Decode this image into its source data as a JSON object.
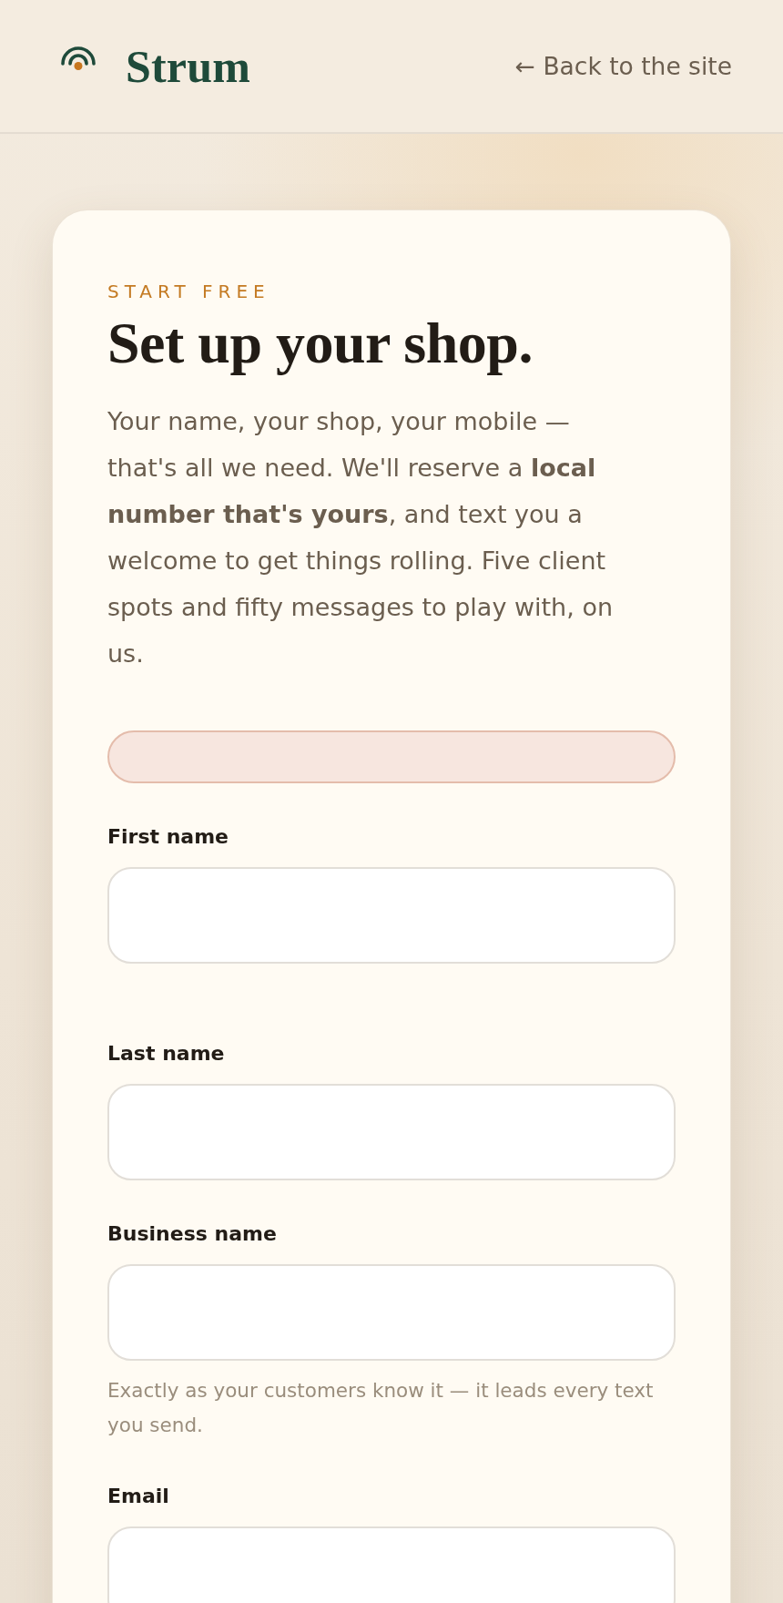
{
  "header": {
    "brand": "Strum",
    "back_link": "← Back to the site"
  },
  "signup": {
    "eyebrow": "START FREE",
    "title": "Set up your shop.",
    "intro": "Your name, your shop, your mobile — that's all we need. We'll reserve a **local number that's yours**, and text you a welcome to get things rolling. Five client spots and fifty messages to play with, on us.",
    "alert": {
      "kind": "error"
    },
    "fields": [
      {
        "label": "First name"
      },
      {
        "label": "Last name"
      },
      {
        "label": "Business name",
        "hint": "Exactly as your customers know it — it leads every text you send."
      },
      {
        "label": "Email"
      }
    ]
  }
}
